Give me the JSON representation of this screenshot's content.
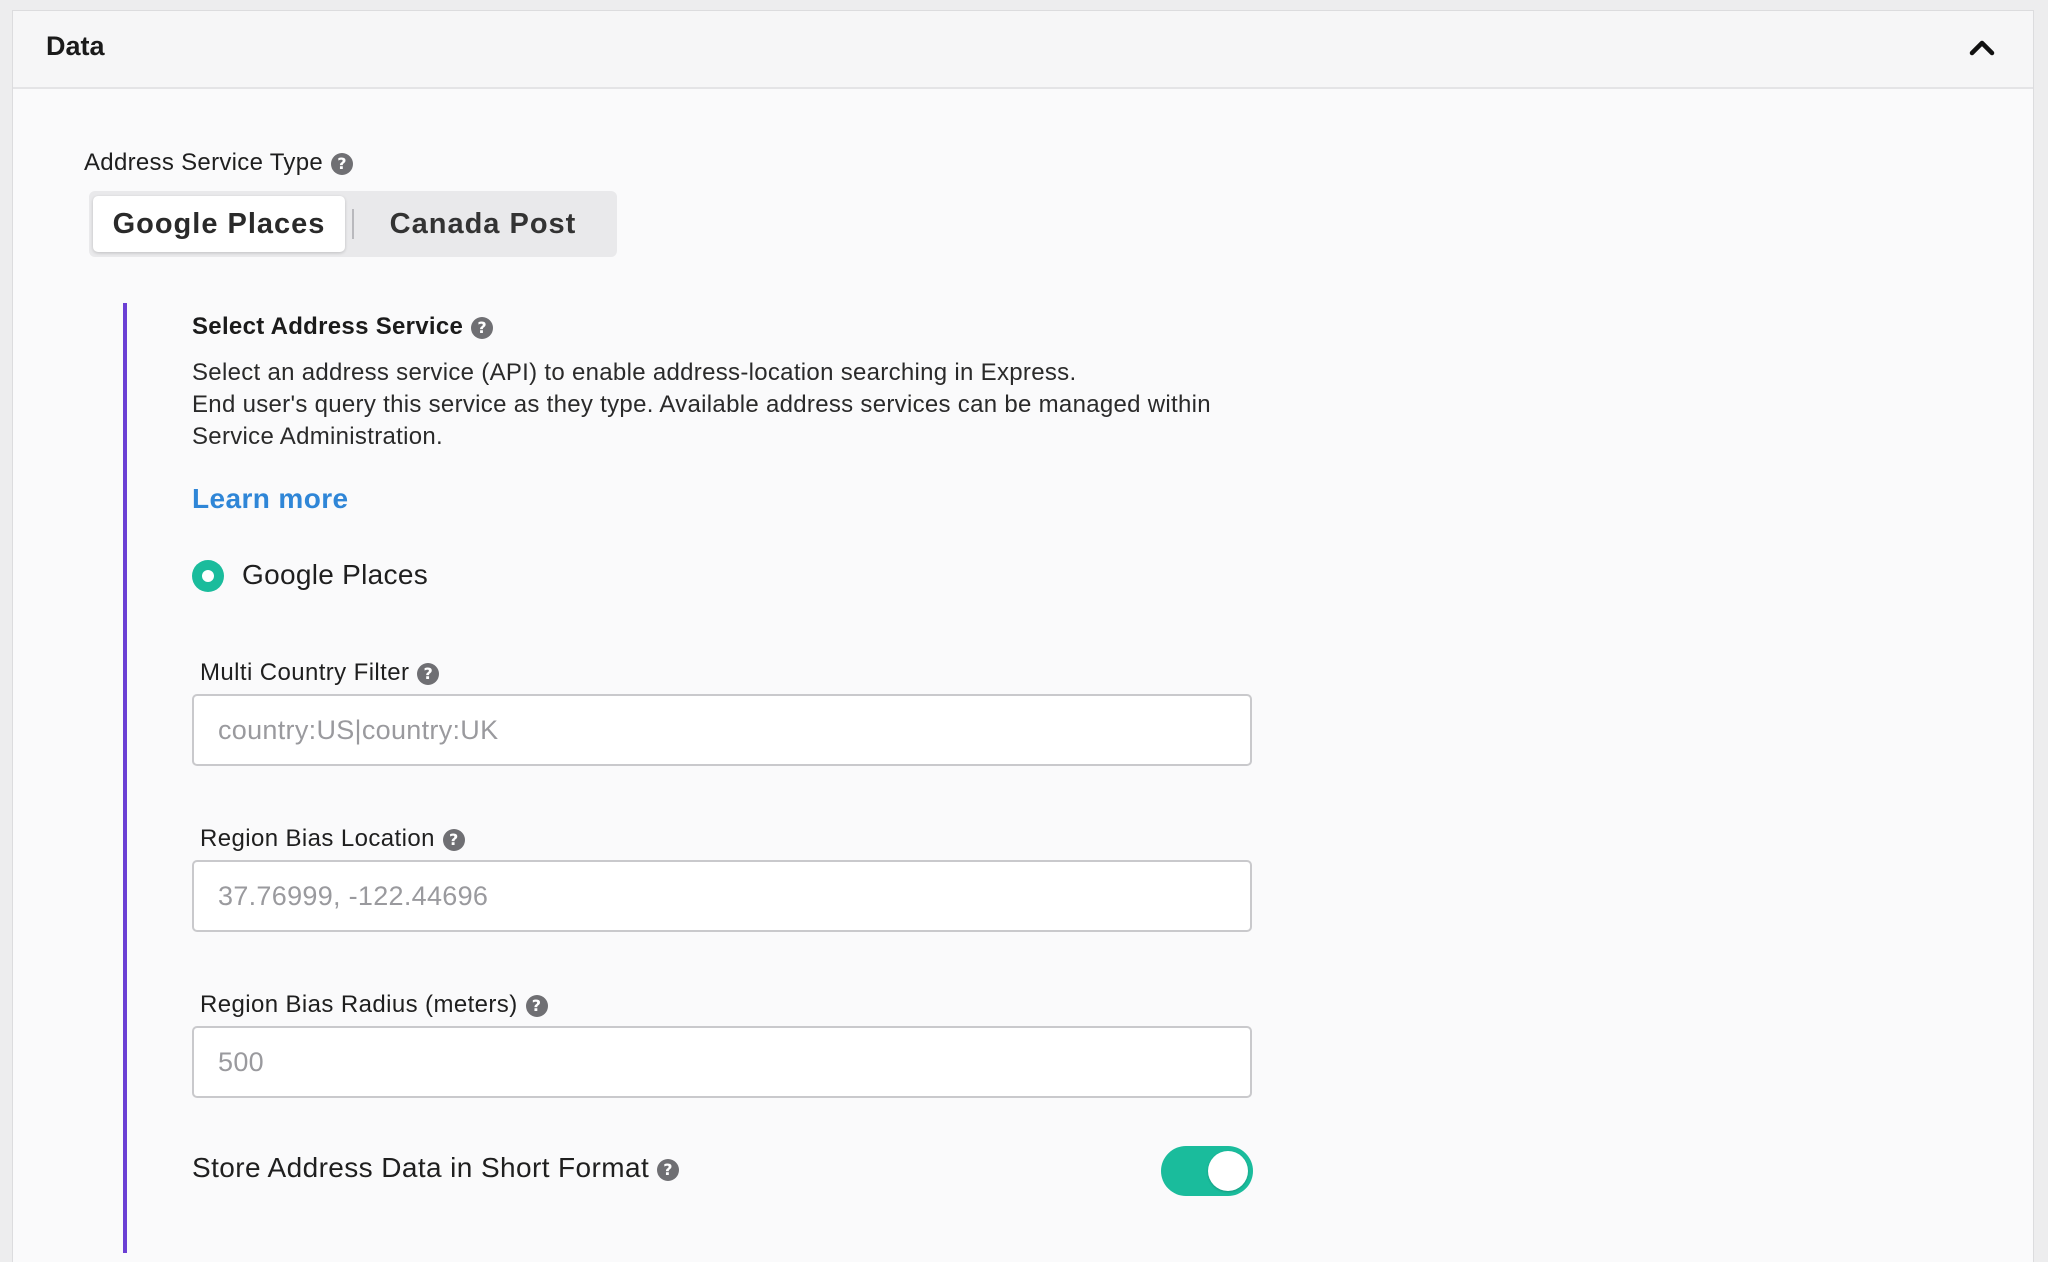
{
  "panel": {
    "title": "Data",
    "collapse_icon": "chevron-up-icon"
  },
  "address_service_type": {
    "label": "Address Service Type",
    "help_icon": "question-circle-icon",
    "options": [
      "Google Places",
      "Canada Post"
    ],
    "selected": "Google Places"
  },
  "select_address_service": {
    "title": "Select Address Service",
    "description_lines": [
      "Select an address service (API) to enable address-location searching in Express.",
      "End user's query this service as they type. Available address services can be managed within",
      "Service Administration."
    ],
    "learn_more": "Learn more",
    "radio_option": "Google Places",
    "radio_selected": true
  },
  "fields": {
    "multi_country_filter": {
      "label": "Multi Country Filter",
      "placeholder": "country:US|country:UK"
    },
    "region_bias_location": {
      "label": "Region Bias Location",
      "placeholder": "37.76999, -122.44696"
    },
    "region_bias_radius": {
      "label": "Region Bias Radius (meters)",
      "placeholder": "500"
    }
  },
  "short_format": {
    "label": "Store Address Data in Short Format",
    "enabled": true
  },
  "colors": {
    "accent_teal": "#1abc9c",
    "accent_purple": "#6b3fd4",
    "link_blue": "#2f86d7"
  }
}
